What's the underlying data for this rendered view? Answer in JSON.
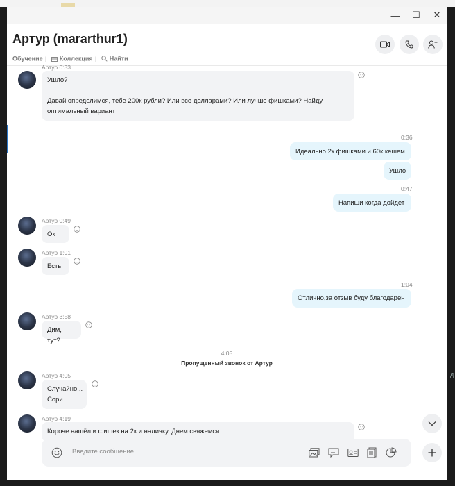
{
  "window": {
    "controls": {
      "minimize": "—",
      "maximize": "☐",
      "close": "✕"
    }
  },
  "header": {
    "title": "Артур (mararthur1)",
    "links": [
      "Обучение",
      "Коллекция",
      "Найти"
    ],
    "separator": "|"
  },
  "messages": [
    {
      "sender": "Артур 0:33",
      "lines": [
        "Ушло?",
        "",
        "Давай определимся, тебе 200к рубли? Или все долларами? Или лучше фишками? Найду оптимальный вариант"
      ]
    },
    {
      "time": "0:36",
      "bubbles": [
        "Идеально 2к фишками и 60к кешем",
        "Ушло"
      ]
    },
    {
      "time": "0:47",
      "bubbles": [
        "Напиши когда дойдет"
      ]
    },
    {
      "sender": "Артур 0:49",
      "lines": [
        "Ок"
      ]
    },
    {
      "sender": "Артур 1:01",
      "lines": [
        "Есть"
      ]
    },
    {
      "time": "1:04",
      "bubbles": [
        "Отлично,за отзыв буду благодарен"
      ]
    },
    {
      "sender": "Артур 3:58",
      "lines": [
        "Дим, тут?"
      ]
    },
    {
      "event_time": "4:05",
      "event_text": "Пропущенный звонок от Артур"
    },
    {
      "sender": "Артур 4:05",
      "lines": [
        "Случайно...",
        "Сори"
      ]
    },
    {
      "sender": "Артур 4:19",
      "lines": [
        "Короче нашёл и фишек на 2к и наличку. Днем свяжемся"
      ]
    }
  ],
  "composer": {
    "placeholder": "Введите сообщение"
  },
  "edge_text": "д",
  "colors": {
    "incoming_bubble": "#f2f3f5",
    "outgoing_bubble": "#e5f5fc",
    "window_bg": "#ffffff",
    "accent": "#2b76c7"
  }
}
